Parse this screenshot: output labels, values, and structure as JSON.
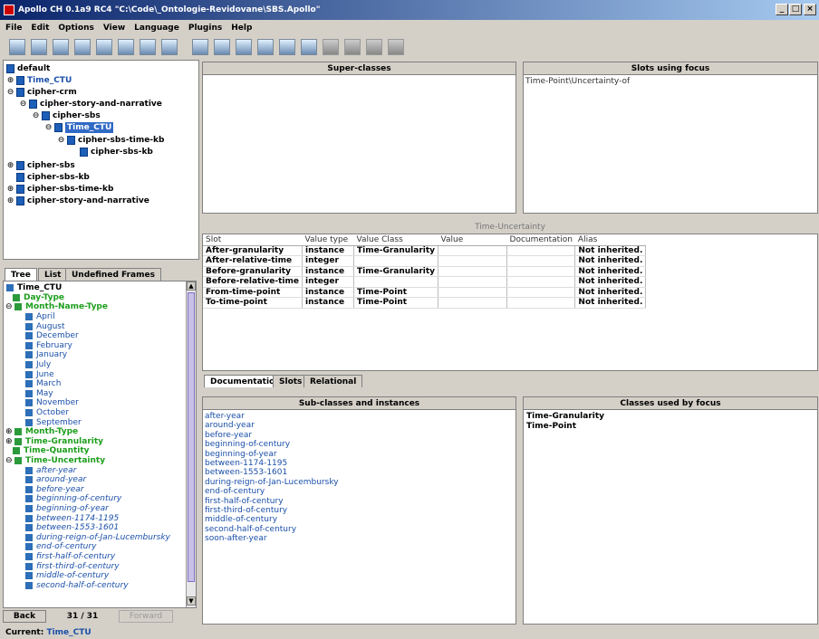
{
  "window": {
    "title": "Apollo CH 0.1a9 RC4 \"C:\\Code\\_Ontologie-Revidovane\\SBS.Apollo\"",
    "controls": [
      "_",
      "□",
      "×"
    ]
  },
  "menu": [
    "File",
    "Edit",
    "Options",
    "View",
    "Language",
    "Plugins",
    "Help"
  ],
  "tree_top": [
    {
      "label": "default",
      "expander": ""
    },
    {
      "label": "Time_CTU",
      "expander": "⊕"
    },
    {
      "label": "cipher-crm",
      "expander": "⊖"
    },
    {
      "label": "cipher-story-and-narrative",
      "expander": "⊖"
    },
    {
      "label": "cipher-sbs",
      "expander": "⊖"
    },
    {
      "label": "Time_CTU",
      "expander": "⊖"
    },
    {
      "label": "cipher-sbs-time-kb",
      "expander": "⊖"
    },
    {
      "label": "cipher-sbs-kb",
      "expander": ""
    },
    {
      "label": "cipher-sbs",
      "expander": "⊕"
    },
    {
      "label": "cipher-sbs-kb",
      "expander": ""
    },
    {
      "label": "cipher-sbs-time-kb",
      "expander": "⊕"
    },
    {
      "label": "cipher-story-and-narrative",
      "expander": "⊕"
    }
  ],
  "left_tabs": [
    "Tree",
    "List",
    "Undefined Frames"
  ],
  "left_tree": [
    {
      "label": "Time_CTU",
      "style": "bold",
      "expander": ""
    },
    {
      "label": "Day-Type",
      "style": "green",
      "expander": ""
    },
    {
      "label": "Month-Name-Type",
      "style": "green",
      "expander": "⊖"
    },
    {
      "label": "April",
      "style": "blue",
      "expander": ""
    },
    {
      "label": "August",
      "style": "blue",
      "expander": ""
    },
    {
      "label": "December",
      "style": "blue",
      "expander": ""
    },
    {
      "label": "February",
      "style": "blue",
      "expander": ""
    },
    {
      "label": "January",
      "style": "blue",
      "expander": ""
    },
    {
      "label": "July",
      "style": "blue",
      "expander": ""
    },
    {
      "label": "June",
      "style": "blue",
      "expander": ""
    },
    {
      "label": "March",
      "style": "blue",
      "expander": ""
    },
    {
      "label": "May",
      "style": "blue",
      "expander": ""
    },
    {
      "label": "November",
      "style": "blue",
      "expander": ""
    },
    {
      "label": "October",
      "style": "blue",
      "expander": ""
    },
    {
      "label": "September",
      "style": "blue",
      "expander": ""
    },
    {
      "label": "Month-Type",
      "style": "green",
      "expander": "⊕"
    },
    {
      "label": "Time-Granularity",
      "style": "green",
      "expander": "⊕"
    },
    {
      "label": "Time-Quantity",
      "style": "green",
      "expander": ""
    },
    {
      "label": "Time-Uncertainty",
      "style": "green",
      "expander": "⊖"
    },
    {
      "label": "after-year",
      "style": "italic",
      "expander": ""
    },
    {
      "label": "around-year",
      "style": "italic",
      "expander": ""
    },
    {
      "label": "before-year",
      "style": "italic",
      "expander": ""
    },
    {
      "label": "beginning-of-century",
      "style": "italic",
      "expander": ""
    },
    {
      "label": "beginning-of-year",
      "style": "italic",
      "expander": ""
    },
    {
      "label": "between-1174-1195",
      "style": "italic",
      "expander": ""
    },
    {
      "label": "between-1553-1601",
      "style": "italic",
      "expander": ""
    },
    {
      "label": "during-reign-of-Jan-Lucembursky",
      "style": "italic",
      "expander": ""
    },
    {
      "label": "end-of-century",
      "style": "italic",
      "expander": ""
    },
    {
      "label": "first-half-of-century",
      "style": "italic",
      "expander": ""
    },
    {
      "label": "first-third-of-century",
      "style": "italic",
      "expander": ""
    },
    {
      "label": "middle-of-century",
      "style": "italic",
      "expander": ""
    },
    {
      "label": "second-half-of-century",
      "style": "italic",
      "expander": ""
    }
  ],
  "nav": {
    "back_label": "Back",
    "counter": "31 / 31",
    "forward_label": "Forward"
  },
  "status": {
    "prefix": "Current:",
    "value": "Time_CTU"
  },
  "superclasses": {
    "header": "Super-classes"
  },
  "slots_using_focus": {
    "header": "Slots using focus",
    "items": [
      "Time-Point\\Uncertainty-of"
    ]
  },
  "frame_title": "Time-Uncertainty",
  "slot_table": {
    "columns": [
      "Slot",
      "Value type",
      "Value Class",
      "Value",
      "Documentation",
      "Alias"
    ],
    "rows": [
      [
        "After-granularity",
        "instance",
        "Time-Granularity",
        "",
        "",
        "Not inherited."
      ],
      [
        "After-relative-time",
        "integer",
        "",
        "",
        "",
        "Not inherited."
      ],
      [
        "Before-granularity",
        "instance",
        "Time-Granularity",
        "",
        "",
        "Not inherited."
      ],
      [
        "Before-relative-time",
        "integer",
        "",
        "",
        "",
        "Not inherited."
      ],
      [
        "From-time-point",
        "instance",
        "Time-Point",
        "",
        "",
        "Not inherited."
      ],
      [
        "To-time-point",
        "instance",
        "Time-Point",
        "",
        "",
        "Not inherited."
      ]
    ]
  },
  "bottom_tabs": [
    "Documentation",
    "Slots",
    "Relational"
  ],
  "subclasses": {
    "header": "Sub-classes and instances",
    "items": [
      "after-year",
      "around-year",
      "before-year",
      "beginning-of-century",
      "beginning-of-year",
      "between-1174-1195",
      "between-1553-1601",
      "during-reign-of-Jan-Lucembursky",
      "end-of-century",
      "first-half-of-century",
      "first-third-of-century",
      "middle-of-century",
      "second-half-of-century",
      "soon-after-year"
    ]
  },
  "classes_used": {
    "header": "Classes used by focus",
    "items": [
      "Time-Granularity",
      "Time-Point"
    ]
  },
  "colors": {
    "title_start": "#0a246a",
    "title_end": "#a6caf0",
    "selection": "#316ac5",
    "class_green": "#1d9e1d",
    "instance_blue": "#1a4fa8"
  }
}
